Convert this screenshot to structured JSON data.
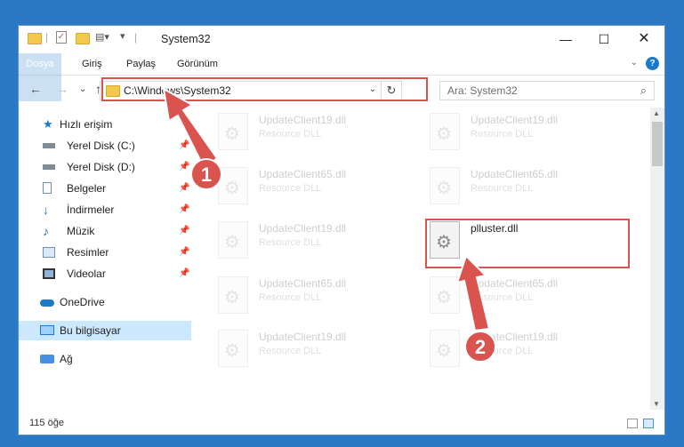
{
  "window": {
    "title": "System32"
  },
  "ribbon": {
    "tabs": [
      "Dosya",
      "Giriş",
      "Paylaş",
      "Görünüm"
    ]
  },
  "nav": {
    "address": "C:\\Windows\\System32",
    "search_placeholder": "Ara: System32"
  },
  "sidebar": {
    "items": [
      {
        "label": "Hızlı erişim",
        "icon": "star-icon"
      },
      {
        "label": "Yerel Disk (C:)",
        "icon": "drive-icon",
        "pinned": true
      },
      {
        "label": "Yerel Disk (D:)",
        "icon": "drive-icon",
        "pinned": true
      },
      {
        "label": "Belgeler",
        "icon": "document-icon",
        "pinned": true
      },
      {
        "label": "İndirmeler",
        "icon": "download-icon",
        "pinned": true
      },
      {
        "label": "Müzik",
        "icon": "music-icon",
        "pinned": true
      },
      {
        "label": "Resimler",
        "icon": "pictures-icon",
        "pinned": true
      },
      {
        "label": "Videolar",
        "icon": "video-icon",
        "pinned": true
      },
      {
        "label": "OneDrive",
        "icon": "cloud-icon"
      },
      {
        "label": "Bu bilgisayar",
        "icon": "computer-icon",
        "selected": true
      },
      {
        "label": "Ağ",
        "icon": "network-icon"
      }
    ]
  },
  "files": [
    {
      "name": "UpdateClient19.dll",
      "type": "Resource DLL"
    },
    {
      "name": "UpdateClient19.dll",
      "type": "Resource DLL"
    },
    {
      "name": "UpdateClient65.dll",
      "type": "Resource DLL"
    },
    {
      "name": "UpdateClient65.dll",
      "type": "Resource DLL"
    },
    {
      "name": "UpdateClient19.dll",
      "type": "Resource DLL"
    },
    {
      "name": "plluster.dll",
      "type": ""
    },
    {
      "name": "UpdateClient65.dll",
      "type": "Resource DLL"
    },
    {
      "name": "UpdateClient65.dll",
      "type": "Resource DLL"
    },
    {
      "name": "UpdateClient19.dll",
      "type": "Resource DLL"
    },
    {
      "name": "UpdateClient19.dll",
      "type": "Resource DLL"
    }
  ],
  "status": {
    "count": "115 öğe"
  },
  "callouts": {
    "one": "1",
    "two": "2"
  },
  "colors": {
    "accent": "#1979ca",
    "highlight": "#d9534f",
    "selection": "#cce8ff"
  }
}
